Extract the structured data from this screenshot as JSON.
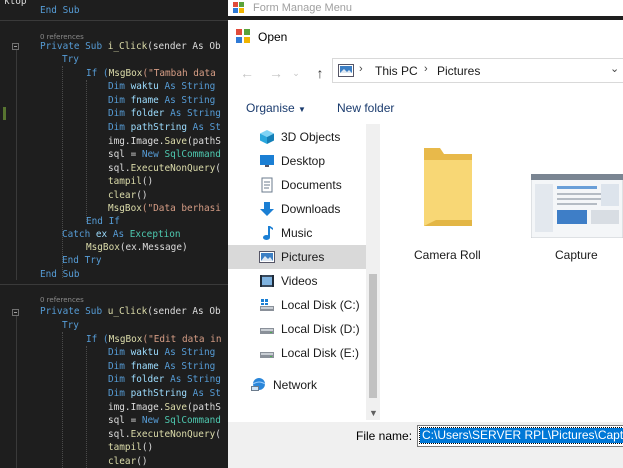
{
  "editor": {
    "header": "ktop",
    "partial_top": "End Sub",
    "reference_hint": "0 references",
    "block1": {
      "sub_decl": [
        "Private Sub ",
        "i_Click",
        "(sender As Ob"
      ],
      "try_kw": "Try",
      "if_line": [
        "If (",
        "MsgBox",
        "(\"Tambah data "
      ],
      "dims": [
        [
          "Dim ",
          "waktu",
          " As String"
        ],
        [
          "Dim ",
          "fname",
          " As String"
        ],
        [
          "Dim ",
          "folder",
          " As String"
        ],
        [
          "Dim ",
          "pathString",
          " As St"
        ]
      ],
      "save": [
        "img.Image.",
        "Save",
        "(pathS"
      ],
      "sql": [
        "sql = ",
        "New ",
        "SqlCommand"
      ],
      "exec": [
        "sql.",
        "ExecuteNonQuery",
        "("
      ],
      "tampil": [
        "tampil",
        "()"
      ],
      "clear": [
        "clear",
        "()"
      ],
      "msg": [
        "MsgBox",
        "(\"Data berhasi"
      ],
      "end_if": "End If",
      "catch": [
        "Catch ",
        "ex",
        " As ",
        "Exception"
      ],
      "catch_msg": [
        "MsgBox",
        "(ex.Message)"
      ],
      "end_try": "End Try",
      "end_sub": "End Sub"
    },
    "block2": {
      "sub_decl": [
        "Private Sub ",
        "u_Click",
        "(sender As Ob"
      ],
      "try_kw": "Try",
      "if_line": [
        "If (",
        "MsgBox",
        "(\"Edit data in"
      ],
      "dims": [
        [
          "Dim ",
          "waktu",
          " As String"
        ],
        [
          "Dim ",
          "fname",
          " As String"
        ],
        [
          "Dim ",
          "folder",
          " As String"
        ],
        [
          "Dim ",
          "pathString",
          " As St"
        ]
      ],
      "save": [
        "img.Image.",
        "Save",
        "(pathS"
      ],
      "sql": [
        "sql = ",
        "New ",
        "SqlCommand"
      ],
      "exec": [
        "sql.",
        "ExecuteNonQuery",
        "("
      ],
      "tampil": [
        "tampil",
        "()"
      ],
      "clear": [
        "clear",
        "()"
      ]
    }
  },
  "background_window": {
    "title": "Form Manage Menu"
  },
  "dialog": {
    "title": "Open",
    "address": {
      "crumbs": [
        "This PC",
        "Pictures"
      ],
      "separator": "›"
    },
    "toolbar": {
      "organise": "Organise",
      "new_folder": "New folder"
    },
    "nav_items": [
      {
        "label": "3D Objects",
        "icon": "cube-3d-icon",
        "selected": false
      },
      {
        "label": "Desktop",
        "icon": "desktop-icon",
        "selected": false
      },
      {
        "label": "Documents",
        "icon": "documents-icon",
        "selected": false
      },
      {
        "label": "Downloads",
        "icon": "downloads-icon",
        "selected": false
      },
      {
        "label": "Music",
        "icon": "music-icon",
        "selected": false
      },
      {
        "label": "Pictures",
        "icon": "pictures-icon",
        "selected": true
      },
      {
        "label": "Videos",
        "icon": "videos-icon",
        "selected": false
      },
      {
        "label": "Local Disk (C:)",
        "icon": "windows-drive-icon",
        "selected": false
      },
      {
        "label": "Local Disk (D:)",
        "icon": "drive-icon",
        "selected": false
      },
      {
        "label": "Local Disk (E:)",
        "icon": "drive-icon",
        "selected": false
      }
    ],
    "network": {
      "label": "Network",
      "icon": "network-icon"
    },
    "files": [
      {
        "label": "Camera Roll",
        "icon": "folder-icon"
      },
      {
        "label": "Capture",
        "icon": "image-thumbnail-icon"
      }
    ],
    "file_name": {
      "label": "File name:",
      "value": "C:\\Users\\SERVER RPL\\Pictures\\Capture"
    },
    "colors": {
      "selection": "#0078d7",
      "folder": "#f8d775",
      "nav_selected": "#d9d9d9"
    }
  }
}
